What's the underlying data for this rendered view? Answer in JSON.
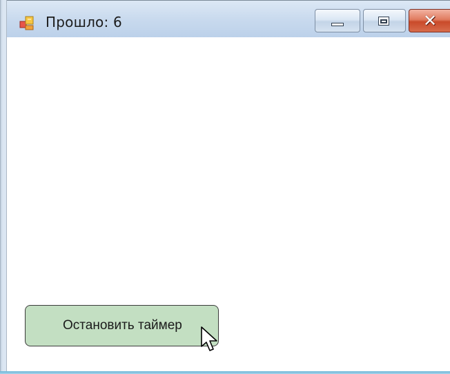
{
  "window": {
    "title": "Прошло: 6",
    "app_icon": "windows-form-icon",
    "controls": {
      "minimize_icon": "minimize-icon",
      "maximize_icon": "maximize-icon",
      "close_icon": "close-icon",
      "close_glyph": "✕"
    }
  },
  "main": {
    "stop_button_label": "Остановить таймер"
  },
  "cursor": {
    "icon": "mouse-pointer-icon"
  },
  "colors": {
    "button_fill": "#c3dfc2",
    "close_button": "#c94a2a",
    "titlebar": "#c9daee"
  }
}
